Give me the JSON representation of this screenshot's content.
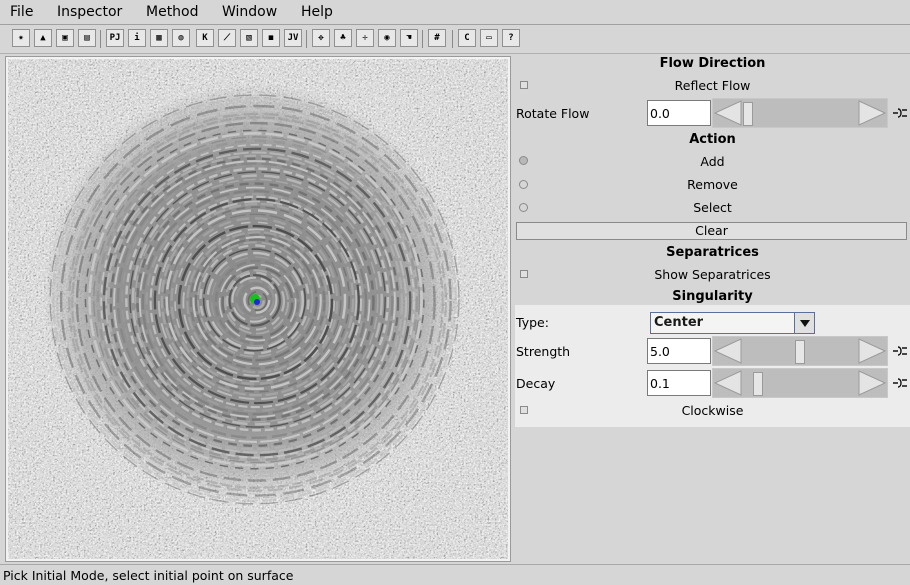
{
  "menubar": {
    "items": [
      "File",
      "Inspector",
      "Method",
      "Window",
      "Help"
    ]
  },
  "toolbar": {
    "buttons": [
      {
        "name": "wand-icon",
        "glyph": "✷"
      },
      {
        "name": "open-icon",
        "glyph": "▲"
      },
      {
        "name": "save-icon",
        "glyph": "▣"
      },
      {
        "name": "print-icon",
        "glyph": "▤"
      },
      {
        "name": "pj-icon",
        "glyph": "PJ"
      },
      {
        "name": "info-icon",
        "glyph": "i"
      },
      {
        "name": "grid-brick-icon",
        "glyph": "▦"
      },
      {
        "name": "globe-icon",
        "glyph": "◍"
      },
      {
        "name": "k-icon",
        "glyph": "K"
      },
      {
        "name": "axes-icon",
        "glyph": "⟋"
      },
      {
        "name": "hatch-icon",
        "glyph": "▧"
      },
      {
        "name": "camera-icon",
        "glyph": "◼"
      },
      {
        "name": "jv-icon",
        "glyph": "JV"
      },
      {
        "name": "pan-icon",
        "glyph": "✥"
      },
      {
        "name": "tree-icon",
        "glyph": "♣"
      },
      {
        "name": "move-icon",
        "glyph": "✛"
      },
      {
        "name": "eye-icon",
        "glyph": "◉"
      },
      {
        "name": "hand-icon",
        "glyph": "☚"
      },
      {
        "name": "grid-icon",
        "glyph": "#"
      },
      {
        "name": "c-icon",
        "glyph": "C"
      },
      {
        "name": "panel-icon",
        "glyph": "▭"
      },
      {
        "name": "help-icon",
        "glyph": "?"
      }
    ]
  },
  "panel": {
    "flow_direction": {
      "title": "Flow Direction",
      "reflect_label": "Reflect Flow",
      "reflect_checked": false,
      "rotate_label": "Rotate Flow",
      "rotate_value": "0.0"
    },
    "action": {
      "title": "Action",
      "options": [
        {
          "label": "Add",
          "selected": true
        },
        {
          "label": "Remove",
          "selected": false
        },
        {
          "label": "Select",
          "selected": false
        }
      ],
      "clear_label": "Clear"
    },
    "separatrices": {
      "title": "Separatrices",
      "show_label": "Show Separatrices",
      "show_checked": false
    },
    "singularity": {
      "title": "Singularity",
      "type_label": "Type:",
      "type_value": "Center",
      "strength_label": "Strength",
      "strength_value": "5.0",
      "decay_label": "Decay",
      "decay_value": "0.1",
      "clockwise_label": "Clockwise",
      "clockwise_checked": false
    }
  },
  "status": {
    "text": "Pick Initial Mode, select initial point on surface"
  },
  "colors": {
    "marker_green": "#16c21a",
    "marker_blue": "#1a2ad6"
  }
}
